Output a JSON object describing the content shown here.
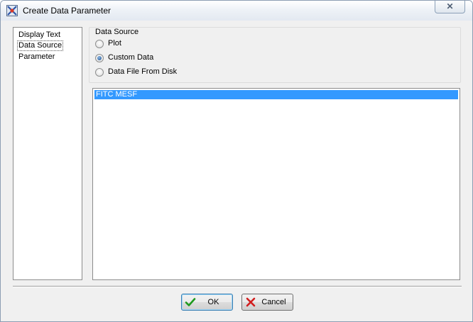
{
  "window": {
    "title": "Create Data Parameter",
    "close_label": "✕"
  },
  "nav": {
    "items": [
      {
        "label": "Display Text",
        "selected": false
      },
      {
        "label": "Data Source",
        "selected": true
      },
      {
        "label": "Parameter",
        "selected": false
      }
    ]
  },
  "data_source": {
    "group_label": "Data Source",
    "options": [
      {
        "label": "Plot",
        "checked": false
      },
      {
        "label": "Custom Data",
        "checked": true
      },
      {
        "label": "Data File From Disk",
        "checked": false
      }
    ]
  },
  "data_list": {
    "items": [
      {
        "label": "FITC MESF",
        "selected": true
      }
    ]
  },
  "buttons": {
    "ok_label": "OK",
    "cancel_label": "Cancel"
  },
  "colors": {
    "selection": "#3399ff",
    "ok_check": "#1e9a1e",
    "cancel_x": "#d21e1e"
  },
  "icons": {
    "app": "flow-cytometry-app-icon",
    "ok": "checkmark-icon",
    "cancel": "red-x-icon",
    "close": "close-icon"
  }
}
